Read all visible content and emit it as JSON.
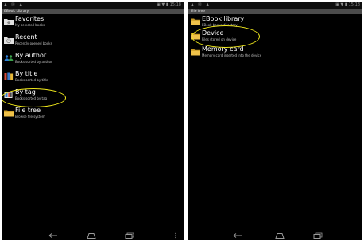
{
  "left_screen": {
    "status": {
      "icons_left": "▲ ✉ ▲",
      "icons_right": "▣ ▼ ▮",
      "clock": "15:18"
    },
    "title": "EBook Library",
    "items": [
      {
        "title": "Favorites",
        "subtitle": "My selected books",
        "icon": "star-folder-icon"
      },
      {
        "title": "Recent",
        "subtitle": "Recently opened books",
        "icon": "clock-folder-icon"
      },
      {
        "title": "By author",
        "subtitle": "Books sorted by author",
        "icon": "people-icon"
      },
      {
        "title": "By title",
        "subtitle": "Books sorted by title",
        "icon": "books-icon"
      },
      {
        "title": "By tag",
        "subtitle": "Books sorted by tag",
        "icon": "tag-icon"
      },
      {
        "title": "File tree",
        "subtitle": "Browse file system",
        "icon": "folder-icon"
      }
    ]
  },
  "right_screen": {
    "status": {
      "icons_left": "▲ ✉ ▲",
      "icons_right": "▣ ▼ ▮",
      "clock": "15:18"
    },
    "title": "File tree",
    "items": [
      {
        "title": "EBook library",
        "subtitle": "EBook books directory",
        "icon": "folder-icon"
      },
      {
        "title": "Device",
        "subtitle": "Files stored on device",
        "icon": "folder-icon"
      },
      {
        "title": "Memory card",
        "subtitle": "Memory card inserted into the device",
        "icon": "folder-icon"
      }
    ]
  },
  "colors": {
    "background": "#000000",
    "highlight": "#f2ea1c",
    "titlebar": "#4b4b4b",
    "folder": "#e6b83a"
  }
}
